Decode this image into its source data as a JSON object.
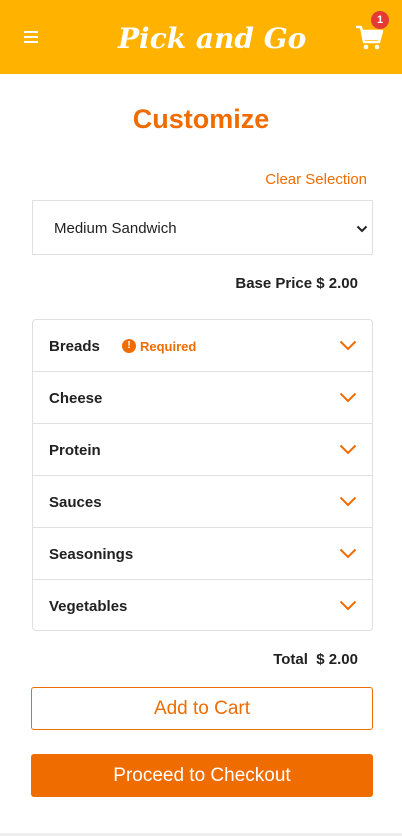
{
  "header": {
    "logo_text": "Pick and Go",
    "cart_count": "1",
    "icons": {
      "menu": "hamburger-menu-icon",
      "cart": "shopping-cart-icon"
    }
  },
  "colors": {
    "header_bg": "#ffb300",
    "accent": "#ef6c00",
    "badge": "#e53935"
  },
  "page": {
    "title": "Customize",
    "clear_selection": "Clear Selection",
    "size_select": {
      "value": "Medium Sandwich"
    },
    "base_price_label": "Base Price",
    "base_price_value": "$ 2.00",
    "required_label": "Required",
    "options": [
      {
        "label": "Breads"
      },
      {
        "label": "Cheese"
      },
      {
        "label": "Protein"
      },
      {
        "label": "Sauces"
      },
      {
        "label": "Seasonings"
      },
      {
        "label": "Vegetables"
      }
    ],
    "total_label": "Total",
    "total_value": "$ 2.00",
    "add_to_cart": "Add to Cart",
    "proceed_checkout": "Proceed to Checkout"
  }
}
